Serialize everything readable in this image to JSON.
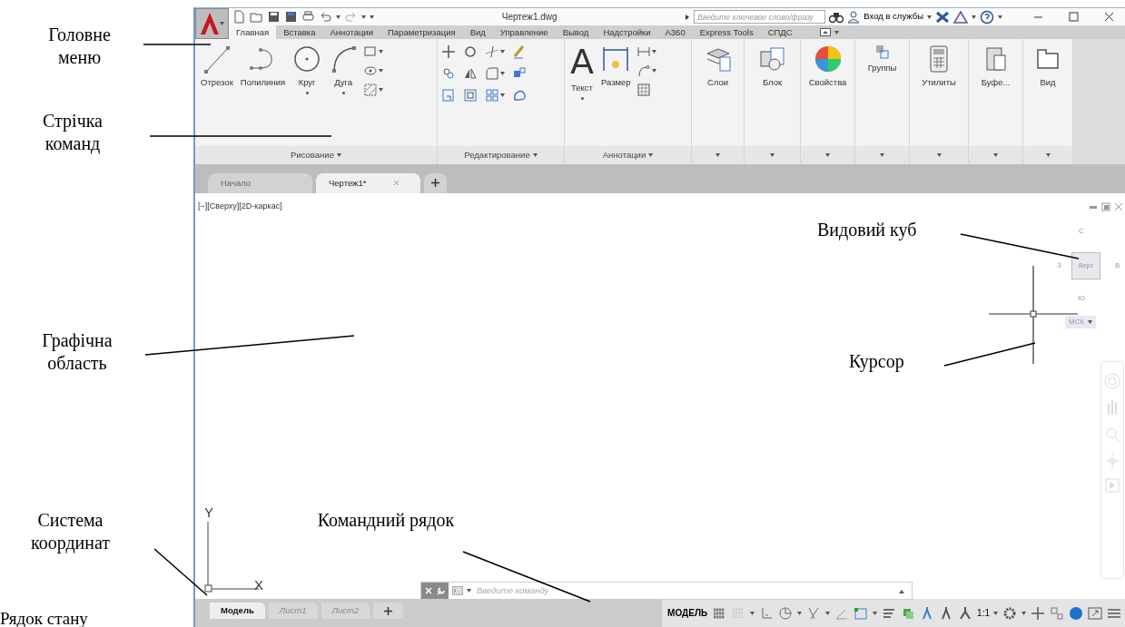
{
  "annotations": [
    {
      "text": "Головне меню"
    },
    {
      "text": "Стрічка команд"
    },
    {
      "text": "Графічна область"
    },
    {
      "text": "Система координат"
    },
    {
      "text": "Командний рядок"
    },
    {
      "text": "Видовий куб"
    },
    {
      "text": "Курсор"
    },
    {
      "text": "Рядок стану"
    }
  ],
  "window": {
    "title": "Чертеж1.dwg"
  },
  "search": {
    "placeholder": "Введите ключевое слово/фразу"
  },
  "sign_in": {
    "label": "Вход в службы"
  },
  "ribbon_tabs": [
    {
      "label": "Главная",
      "selected": true
    },
    {
      "label": "Вставка",
      "selected": false
    },
    {
      "label": "Аннотации",
      "selected": false
    },
    {
      "label": "Параметризация",
      "selected": false
    },
    {
      "label": "Вид",
      "selected": false
    },
    {
      "label": "Управление",
      "selected": false
    },
    {
      "label": "Вывод",
      "selected": false
    },
    {
      "label": "Надстройки",
      "selected": false
    },
    {
      "label": "A360",
      "selected": false
    },
    {
      "label": "Express Tools",
      "selected": false
    },
    {
      "label": "СПДС",
      "selected": false
    }
  ],
  "ribbon_panels": [
    {
      "title": "Рисование",
      "tools": [
        {
          "label": "Отрезок"
        },
        {
          "label": "Полилиния"
        },
        {
          "label": "Круг"
        },
        {
          "label": "Дуга"
        }
      ]
    },
    {
      "title": "Редактирование"
    },
    {
      "title": "Аннотации",
      "tools": [
        {
          "label": "Текст",
          "glyph": "A"
        },
        {
          "label": "Размер"
        }
      ]
    },
    {
      "tools": [
        {
          "label": "Слои"
        }
      ]
    },
    {
      "tools": [
        {
          "label": "Блок"
        }
      ]
    },
    {
      "tools": [
        {
          "label": "Свойства"
        }
      ]
    },
    {
      "tools": [
        {
          "label": "Группы"
        }
      ]
    },
    {
      "tools": [
        {
          "label": "Утилиты"
        }
      ]
    },
    {
      "tools": [
        {
          "label": "Буфе..."
        }
      ]
    },
    {
      "tools": [
        {
          "label": "Вид"
        }
      ]
    }
  ],
  "file_tabs": [
    {
      "label": "Начало",
      "selected": false
    },
    {
      "label": "Чертеж1*",
      "selected": true
    }
  ],
  "viewport_label": "[−][Сверху][2D-каркас]",
  "viewcube": {
    "top": "С",
    "left": "З",
    "face": "Верх",
    "right": "В",
    "bottom": "Ю",
    "ucs": "МСК"
  },
  "ucs": {
    "y": "Y",
    "x": "X"
  },
  "command_line": {
    "placeholder": "Введите команду"
  },
  "layout_tabs": [
    {
      "label": "Модель",
      "selected": true
    },
    {
      "label": "Лист1",
      "selected": false
    },
    {
      "label": "Лист2",
      "selected": false
    }
  ],
  "status_bar": {
    "space": "МОДЕЛЬ",
    "scale": "1:1"
  }
}
